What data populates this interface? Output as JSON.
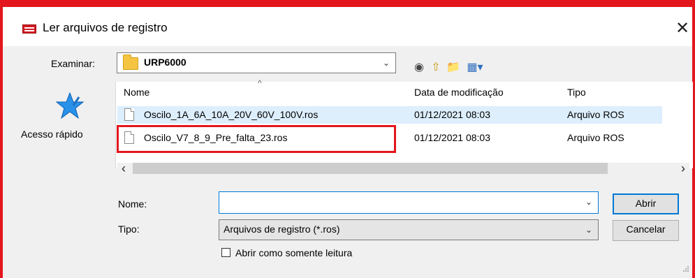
{
  "window": {
    "title": "Ler arquivos de registro",
    "close_label": "✕"
  },
  "location": {
    "label": "Examinar:",
    "value": "URP6000",
    "dropdown": "⌄"
  },
  "toolbar": [
    {
      "name": "back-icon",
      "glyph": "◉",
      "color": "#444444"
    },
    {
      "name": "up-folder-icon",
      "glyph": "⇧",
      "color": "#c99a11"
    },
    {
      "name": "new-folder-icon",
      "glyph": "📁",
      "color": "#c99a11"
    },
    {
      "name": "view-menu-icon",
      "glyph": "▦▾",
      "color": "#2f6fbf"
    }
  ],
  "sidebar": {
    "item": "Acesso rápido"
  },
  "columns": {
    "name": "Nome",
    "date": "Data de modificação",
    "type": "Tipo",
    "sort_arrow": "^"
  },
  "files": [
    {
      "name": "Oscilo_1A_6A_10A_20V_60V_100V.ros",
      "date": "01/12/2021 08:03",
      "type": "Arquivo ROS"
    },
    {
      "name": "Oscilo_V7_8_9_Pre_falta_23.ros",
      "date": "01/12/2021 08:03",
      "type": "Arquivo ROS"
    }
  ],
  "scroll": {
    "left": "‹",
    "right": "›"
  },
  "form": {
    "name_label": "Nome:",
    "name_value": "",
    "type_label": "Tipo:",
    "type_value": "Arquivos de registro (*.ros)",
    "readonly_label": "Abrir como somente leitura"
  },
  "buttons": {
    "open": "Abrir",
    "cancel": "Cancelar"
  },
  "colors": {
    "highlight": "#e3161d",
    "selection": "#ddeefd",
    "accent": "#0078d7"
  }
}
